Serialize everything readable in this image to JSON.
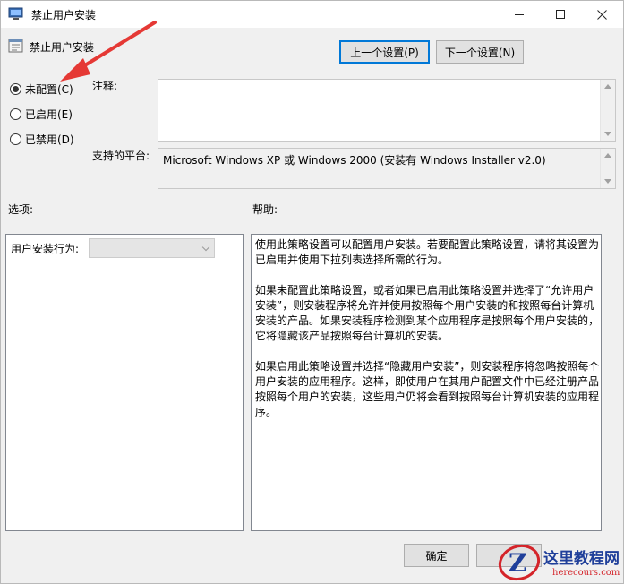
{
  "window": {
    "title": "禁止用户安装",
    "header_title": "禁止用户安装"
  },
  "nav": {
    "prev_label": "上一个设置(P)",
    "next_label": "下一个设置(N)"
  },
  "state": {
    "options": [
      {
        "label": "未配置(C)",
        "selected": true
      },
      {
        "label": "已启用(E)",
        "selected": false
      },
      {
        "label": "已禁用(D)",
        "selected": false
      }
    ]
  },
  "comment": {
    "label": "注释:",
    "value": ""
  },
  "platform": {
    "label": "支持的平台:",
    "value": "Microsoft Windows XP 或 Windows 2000 (安装有 Windows Installer v2.0)"
  },
  "options_panel": {
    "label": "选项:",
    "behavior_label": "用户安装行为:",
    "behavior_value": ""
  },
  "help_panel": {
    "label": "帮助:",
    "paragraphs": [
      "使用此策略设置可以配置用户安装。若要配置此策略设置，请将其设置为已启用并使用下拉列表选择所需的行为。",
      "如果未配置此策略设置，或者如果已启用此策略设置并选择了“允许用户安装”，则安装程序将允许并使用按照每个用户安装的和按照每台计算机安装的产品。如果安装程序检测到某个应用程序是按照每个用户安装的，它将隐藏该产品按照每台计算机的安装。",
      "如果启用此策略设置并选择“隐藏用户安装”，则安装程序将忽略按照每个用户安装的应用程序。这样，即使用户在其用户配置文件中已经注册产品按照每个用户的安装，这些用户仍将会看到按照每台计算机安装的应用程序。"
    ]
  },
  "footer": {
    "ok_label": "确定",
    "cancel_label": ""
  },
  "watermark": {
    "name": "这里教程网",
    "url": "herecours.com",
    "letter": "Z"
  },
  "colors": {
    "accent": "#0078d7",
    "annotation_arrow": "#e53935"
  }
}
